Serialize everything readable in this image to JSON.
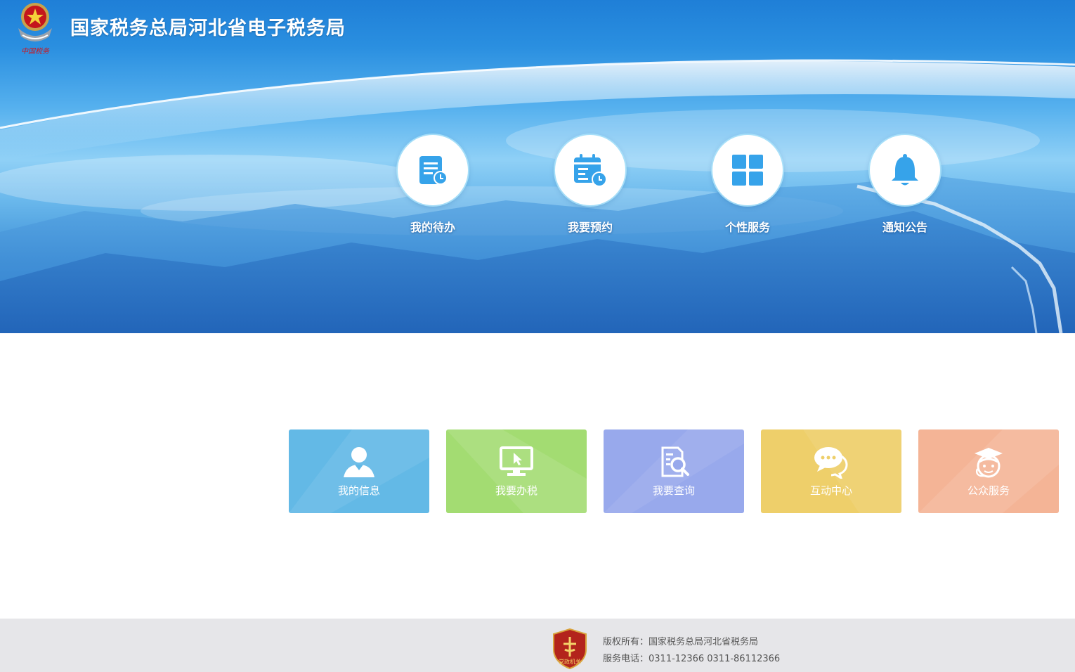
{
  "header": {
    "title": "国家税务总局河北省电子税务局",
    "logo_text": "中国税务"
  },
  "quick_links": [
    {
      "label": "我的待办",
      "icon": "todo-list-icon"
    },
    {
      "label": "我要预约",
      "icon": "calendar-clock-icon"
    },
    {
      "label": "个性服务",
      "icon": "grid-icon"
    },
    {
      "label": "通知公告",
      "icon": "bell-icon"
    }
  ],
  "tiles": [
    {
      "label": "我的信息",
      "icon": "user-icon",
      "color": "#63b9e6"
    },
    {
      "label": "我要办税",
      "icon": "monitor-cursor-icon",
      "color": "#a3dc72"
    },
    {
      "label": "我要查询",
      "icon": "document-search-icon",
      "color": "#98a9ec"
    },
    {
      "label": "互动中心",
      "icon": "chat-bubbles-icon",
      "color": "#eecf6a"
    },
    {
      "label": "公众服务",
      "icon": "graduate-avatar-icon",
      "color": "#f4b496"
    }
  ],
  "footer": {
    "copyright": "版权所有：国家税务总局河北省税务局",
    "phone": "服务电话：0311-12366 0311-86112366",
    "badge_text": "党政机关"
  },
  "colors": {
    "header_blue": "#1f7fd7",
    "icon_blue": "#36a3ea",
    "footer_bg": "#e6e6e9"
  }
}
